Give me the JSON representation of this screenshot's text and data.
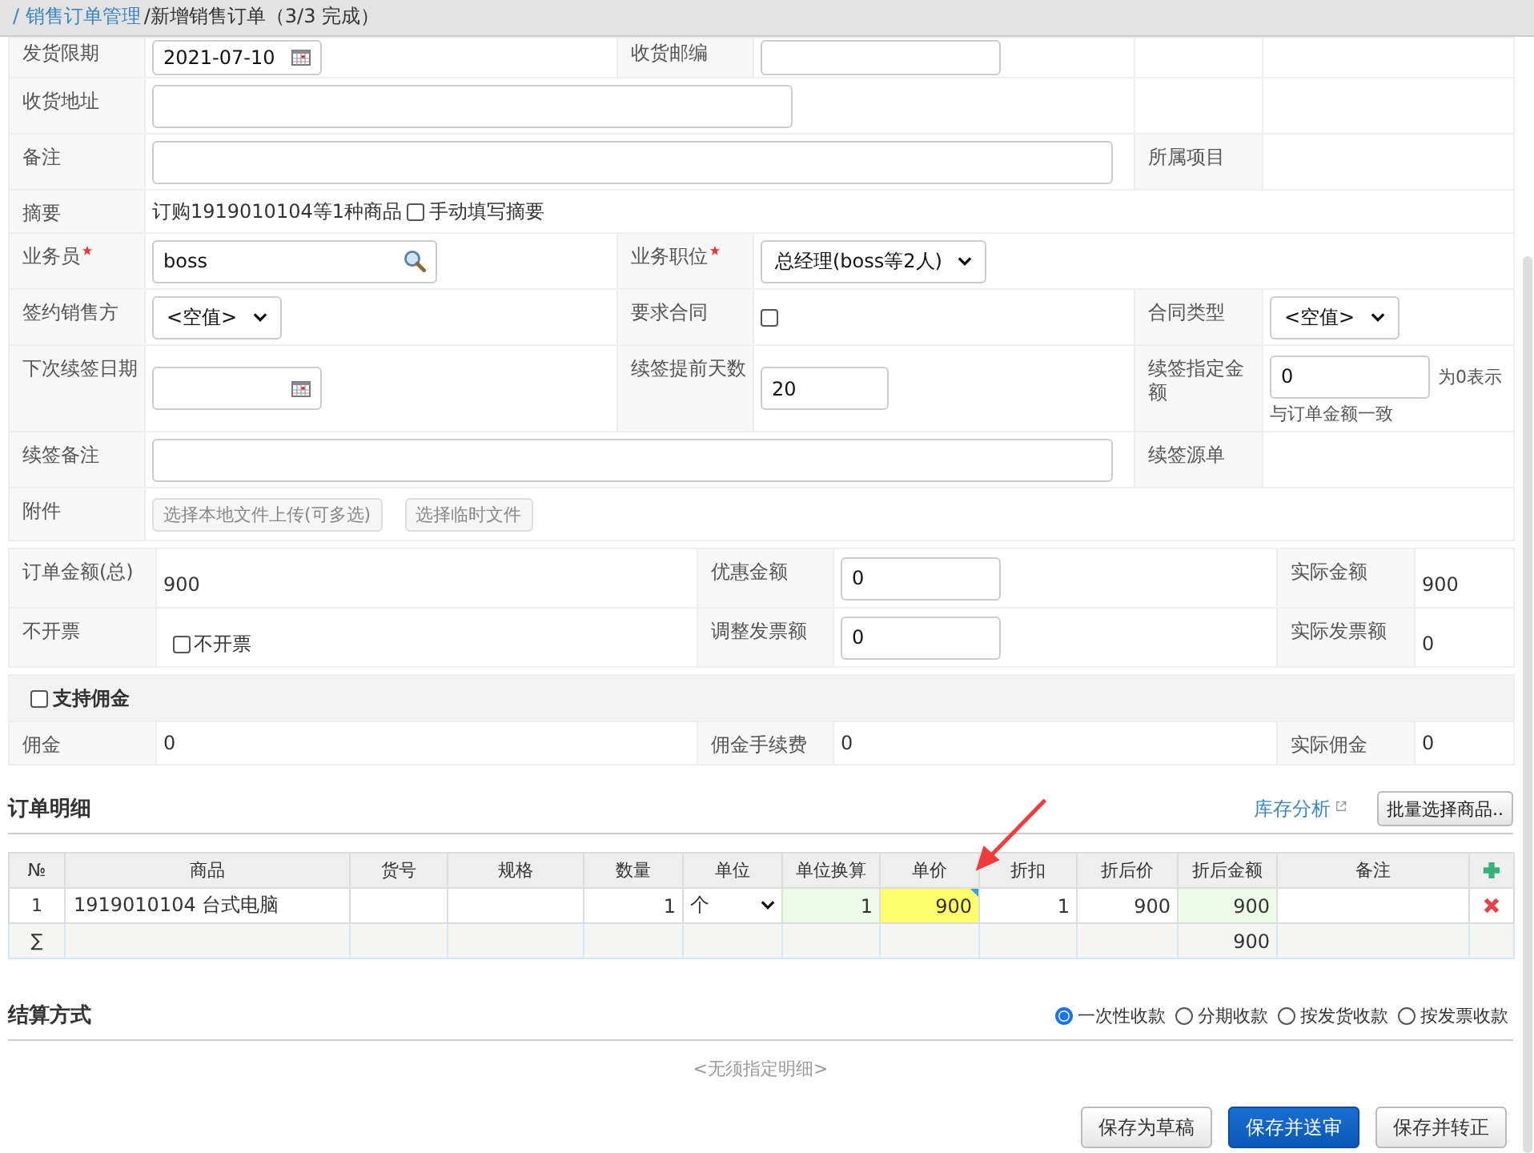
{
  "breadcrumb": [
    {
      "kind": "link",
      "text": "/ 销售订单管理"
    },
    {
      "kind": "text",
      "text": "/新增销售订单（3/3 完成）"
    }
  ],
  "form": [
    {
      "cells": [
        {
          "kind": "label",
          "text": "发货限期"
        },
        {
          "kind": "date",
          "value": "2021-07-10"
        },
        {
          "kind": "label",
          "text": "收货邮编"
        },
        {
          "kind": "input"
        },
        {
          "kind": "empty"
        },
        {
          "kind": "empty"
        }
      ]
    },
    {
      "cells": [
        {
          "kind": "label",
          "text": "收货地址"
        },
        {
          "kind": "half-input"
        },
        {
          "kind": "empty"
        },
        {
          "kind": "empty"
        }
      ]
    },
    {
      "cells": [
        {
          "kind": "label",
          "text": "备注"
        },
        {
          "kind": "long-input"
        },
        {
          "kind": "label",
          "text": "所属项目"
        },
        {
          "kind": "empty"
        }
      ]
    },
    {
      "cells": [
        {
          "kind": "label",
          "text": "摘要"
        },
        {
          "kind": "summary",
          "text": "订购1919010104等1种商品",
          "check_label": "手动填写摘要",
          "checked": false
        }
      ]
    },
    {
      "cells": [
        {
          "kind": "label",
          "text": "业务员",
          "required": true
        },
        {
          "kind": "search",
          "value": "boss"
        },
        {
          "kind": "label",
          "text": "业务职位",
          "required": true
        },
        {
          "kind": "select",
          "value": "总经理(boss等2人)"
        }
      ]
    },
    {
      "cells": [
        {
          "kind": "label",
          "text": "签约销售方"
        },
        {
          "kind": "select",
          "value": "<空值>"
        },
        {
          "kind": "label",
          "text": "要求合同"
        },
        {
          "kind": "checkbox",
          "checked": false
        },
        {
          "kind": "label",
          "text": "合同类型"
        },
        {
          "kind": "select",
          "value": "<空值>"
        }
      ]
    },
    {
      "cells": [
        {
          "kind": "label",
          "text": "下次续签日期"
        },
        {
          "kind": "date"
        },
        {
          "kind": "label",
          "text": "续签提前天数"
        },
        {
          "kind": "short-input",
          "value": "20"
        },
        {
          "kind": "label",
          "text": "续签指定金额"
        },
        {
          "kind": "amount",
          "value": "0",
          "note": [
            "为0表示",
            "与订单金额一致"
          ]
        }
      ]
    },
    {
      "cells": [
        {
          "kind": "label",
          "text": "续签备注"
        },
        {
          "kind": "long-input"
        },
        {
          "kind": "label",
          "text": "续签源单"
        },
        {
          "kind": "empty"
        }
      ]
    },
    {
      "cells": [
        {
          "kind": "label",
          "text": "附件"
        },
        {
          "kind": "buttons",
          "buttons": [
            "选择本地文件上传(可多选)",
            "选择临时文件"
          ]
        }
      ]
    }
  ],
  "summary": [
    {
      "cells": [
        {
          "kind": "label",
          "text": "订单金额(总)"
        },
        {
          "kind": "text",
          "text": "900"
        },
        {
          "kind": "label",
          "text": "优惠金额"
        },
        {
          "kind": "input",
          "value": "0"
        },
        {
          "kind": "label",
          "text": "实际金额"
        },
        {
          "kind": "text",
          "text": "900"
        }
      ]
    },
    {
      "cells": [
        {
          "kind": "label",
          "text": "不开票"
        },
        {
          "kind": "check",
          "check_label": "不开票",
          "checked": false
        },
        {
          "kind": "label",
          "text": "调整发票额"
        },
        {
          "kind": "input",
          "value": "0"
        },
        {
          "kind": "label",
          "text": "实际发票额"
        },
        {
          "kind": "text",
          "text": "0"
        }
      ]
    }
  ],
  "commission": {
    "label": "支持佣金",
    "enabled": false,
    "cells": [
      {
        "kind": "label",
        "text": "佣金"
      },
      {
        "kind": "text",
        "text": "0"
      },
      {
        "kind": "label",
        "text": "佣金手续费"
      },
      {
        "kind": "text",
        "text": "0"
      },
      {
        "kind": "label",
        "text": "实际佣金"
      },
      {
        "kind": "text",
        "text": "0"
      }
    ]
  },
  "details": {
    "title": "订单明细",
    "link": "库存分析",
    "batch_button": "批量选择商品..",
    "columns": [
      "№",
      "商品",
      "货号",
      "规格",
      "数量",
      "单位",
      "单位换算",
      "单价",
      "折扣",
      "折后价",
      "折后金额",
      "备注"
    ],
    "rows": [
      {
        "cells": [
          {
            "kind": "index",
            "text": "1"
          },
          {
            "kind": "input",
            "text": "1919010104 台式电脑"
          },
          {
            "kind": "blank"
          },
          {
            "kind": "blank"
          },
          {
            "kind": "number",
            "text": "1"
          },
          {
            "kind": "select",
            "text": "个"
          },
          {
            "kind": "computed",
            "text": "1"
          },
          {
            "kind": "highlight",
            "text": "900"
          },
          {
            "kind": "number",
            "text": "1"
          },
          {
            "kind": "number",
            "text": "900"
          },
          {
            "kind": "computed",
            "text": "900"
          },
          {
            "kind": "input"
          }
        ]
      }
    ],
    "totals": [
      {
        "kind": "symbol",
        "text": "∑"
      },
      {
        "kind": "blank"
      },
      {
        "kind": "blank"
      },
      {
        "kind": "blank"
      },
      {
        "kind": "blank"
      },
      {
        "kind": "blank"
      },
      {
        "kind": "blank"
      },
      {
        "kind": "blank"
      },
      {
        "kind": "blank"
      },
      {
        "kind": "blank"
      },
      {
        "kind": "sum",
        "text": "900"
      },
      {
        "kind": "blank"
      }
    ]
  },
  "settlement": {
    "title": "结算方式",
    "options": [
      {
        "label": "一次性收款",
        "selected": true
      },
      {
        "label": "分期收款",
        "selected": false
      },
      {
        "label": "按发货收款",
        "selected": false
      },
      {
        "label": "按发票收款",
        "selected": false
      }
    ],
    "note": "<无须指定明细>"
  },
  "buttons": [
    {
      "kind": "default",
      "label": "保存为草稿"
    },
    {
      "kind": "primary",
      "label": "保存并送审"
    },
    {
      "kind": "default",
      "label": "保存并转正"
    }
  ]
}
